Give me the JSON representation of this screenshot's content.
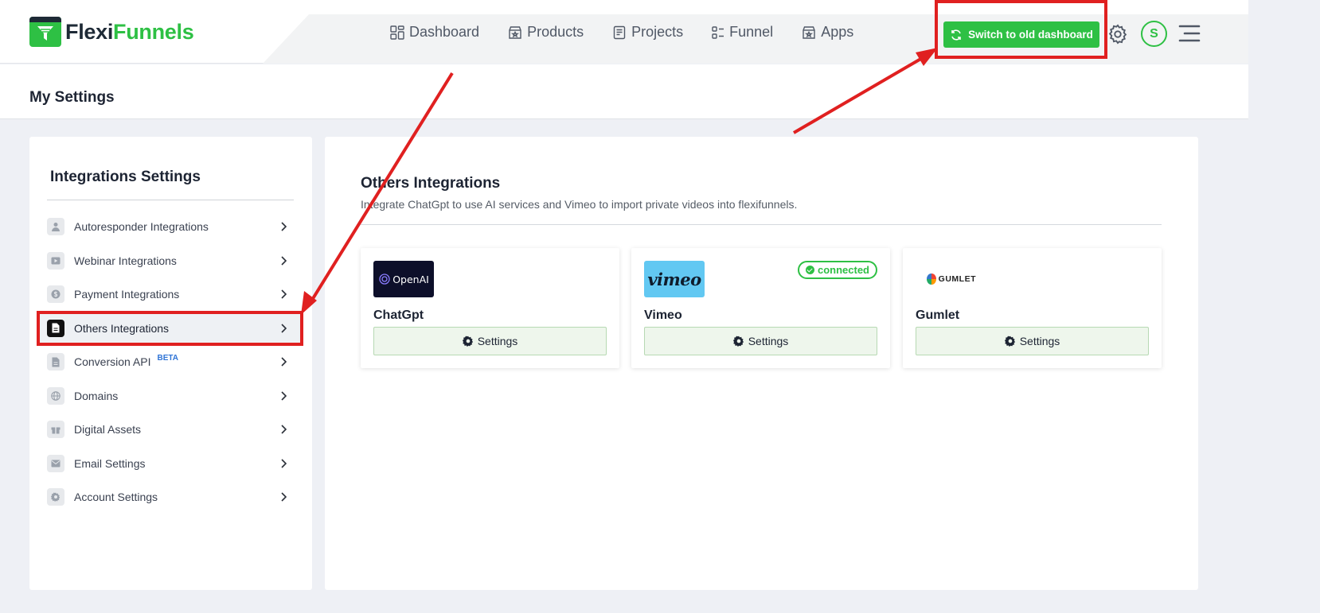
{
  "brand": {
    "part1": "Flexi",
    "part2": "Funnels"
  },
  "nav": {
    "items": [
      {
        "label": "Dashboard",
        "icon": "grid-icon"
      },
      {
        "label": "Products",
        "icon": "store-icon"
      },
      {
        "label": "Projects",
        "icon": "document-icon"
      },
      {
        "label": "Funnel",
        "icon": "funnel-icon"
      },
      {
        "label": "Apps",
        "icon": "store-icon"
      }
    ]
  },
  "header": {
    "switch_label": "Switch to old dashboard",
    "avatar_initial": "S"
  },
  "page": {
    "title": "My Settings"
  },
  "sidebar": {
    "title": "Integrations Settings",
    "items": [
      {
        "label": "Autoresponder Integrations",
        "icon": "user-icon"
      },
      {
        "label": "Webinar Integrations",
        "icon": "play-icon"
      },
      {
        "label": "Payment Integrations",
        "icon": "dollar-icon"
      },
      {
        "label": "Others Integrations",
        "icon": "file-icon",
        "active": true
      },
      {
        "label": "Conversion API",
        "icon": "file-icon",
        "badge": "BETA"
      },
      {
        "label": "Domains",
        "icon": "globe-icon"
      },
      {
        "label": "Digital Assets",
        "icon": "gift-icon"
      },
      {
        "label": "Email Settings",
        "icon": "mail-icon"
      },
      {
        "label": "Account Settings",
        "icon": "gear-icon"
      }
    ]
  },
  "content": {
    "title": "Others Integrations",
    "description": "Integrate ChatGpt to use AI services and Vimeo to import private videos into flexifunnels.",
    "cards": [
      {
        "name": "ChatGpt",
        "logo_text": "OpenAI",
        "button": "Settings"
      },
      {
        "name": "Vimeo",
        "logo_text": "vimeo",
        "button": "Settings",
        "status": "connected"
      },
      {
        "name": "Gumlet",
        "logo_text": "GUMLET",
        "button": "Settings"
      }
    ]
  },
  "colors": {
    "brand_green": "#2ec044",
    "annotation_red": "#e02020",
    "dark": "#1e2a36"
  }
}
